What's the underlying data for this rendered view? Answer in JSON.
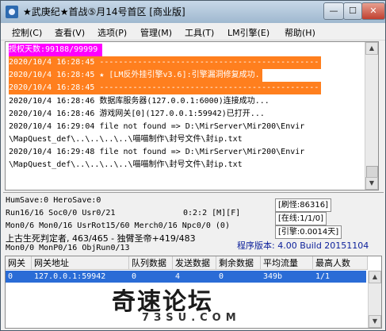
{
  "window": {
    "title": "★武庚纪★首战⑤月14号首区 [商业版]",
    "min_symbol": "—",
    "max_symbol": "☐",
    "close_symbol": "✕"
  },
  "menu": {
    "items": [
      "控制(C)",
      "查看(V)",
      "选项(P)",
      "管理(M)",
      "工具(T)",
      "LM引擎(E)",
      "帮助(H)"
    ]
  },
  "log": {
    "lines": [
      {
        "text": "授权天数:99188/99999",
        "style": "magenta"
      },
      {
        "text": "2020/10/4 16:28:45 ----------------------------------------------",
        "style": "orange"
      },
      {
        "text": "2020/10/4 16:28:45 ★ [LM反外挂引擎v3.6]:引擎漏洞修复成功.",
        "style": "orange"
      },
      {
        "text": "2020/10/4 16:28:45 ----------------------------------------------",
        "style": "orange"
      },
      {
        "text": "2020/10/4 16:28:46 数据库服务器(127.0.0.1:6000)连接成功...",
        "style": "normal"
      },
      {
        "text": "2020/10/4 16:28:46 游戏网关[0](127.0.0.1:59942)已打开...",
        "style": "normal"
      },
      {
        "text": "2020/10/4 16:29:04 file not found => D:\\MirServer\\Mir200\\Envir",
        "style": "normal"
      },
      {
        "text": "\\MapQuest_def\\..\\..\\..\\..\\喵喵制作\\封号文件\\封ip.txt",
        "style": "normal"
      },
      {
        "text": "2020/10/4 16:29:48 file not found => D:\\MirServer\\Mir200\\Envir",
        "style": "normal"
      },
      {
        "text": "\\MapQuest_def\\..\\..\\..\\..\\喵喵制作\\封号文件\\封ip.txt",
        "style": "normal"
      }
    ]
  },
  "status": {
    "humsave": "HumSave:0 HeroSave:0",
    "run": "Run16/16 Soc0/0 Usr0/21",
    "time": "0:2:2 [M][F]",
    "mon": "Mon0/6 Mon0/16 UsrRot15/60 Merch0/16 Npc0/0 (0)",
    "bottom_line_text": "上古生死判定者, 463/465 - 独臂圣帝+419/483",
    "monpo": "Mon0/0 MonP0/16 ObjRun0/13",
    "refresh": "[刷怪:86316]",
    "online": "[在线:1/1/0]",
    "engine": "[引擎:0.0014天]",
    "version": "程序版本: 4.00 Build 20151104"
  },
  "gateway_table": {
    "columns": [
      "网关",
      "网关地址",
      "队列数据",
      "发送数据",
      "剩余数据",
      "平均流量",
      "最高人数"
    ],
    "rows": [
      [
        "0",
        "127.0.0.1:59942",
        "0",
        "4",
        "0",
        "349b",
        "1/1"
      ]
    ]
  },
  "watermark": {
    "text": "奇速论坛",
    "sub": "7ЗSU.COM"
  }
}
